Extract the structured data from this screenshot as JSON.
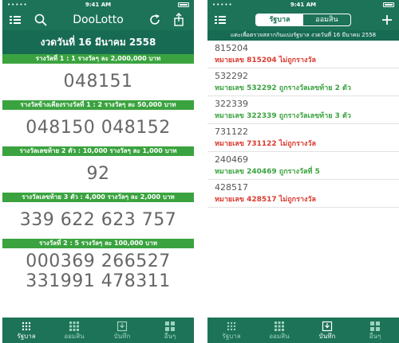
{
  "status": {
    "carrier": "•••••",
    "time": "9:41 AM"
  },
  "left": {
    "nav_title": "DooLotto",
    "date_header": "งวดวันที่ 16 มีนาคม 2558",
    "sections": [
      {
        "label": "รางวัลที่ 1 : 1 รางวัลๆ ละ 2,000,000 บาท",
        "numbers": [
          "048151"
        ]
      },
      {
        "label": "รางวัลข้างเคียงรางวัลที่ 1 : 2 รางวัลๆ ละ 50,000 บาท",
        "numbers": [
          "048150 048152"
        ]
      },
      {
        "label": "รางวัลเลขท้าย 2 ตัว : 10,000 รางวัลๆ ละ 1,000 บาท",
        "numbers": [
          "92"
        ]
      },
      {
        "label": "รางวัลเลขท้าย 3 ตัว : 4,000 รางวัลๆ ละ 2,000 บาท",
        "numbers": [
          "339 622 623 757"
        ]
      },
      {
        "label": "รางวัลที่ 2 : 5 รางวัลๆ ละ 100,000 บาท",
        "numbers": [
          "000369 266527",
          "331991 478311"
        ]
      }
    ]
  },
  "tabs": [
    "รัฐบาล",
    "ออมสิน",
    "บันทึก",
    "อื่นๆ"
  ],
  "right": {
    "segments": [
      "รัฐบาล",
      "ออมสิน"
    ],
    "info": "แตะเพื่อตรวจสลากกินแบ่งรัฐบาล งวดวันที่ 16 มีนาคม 2558",
    "entries": [
      {
        "number": "815204",
        "result": "หมายเลข 815204 ไม่ถูกรางวัล",
        "status": "lost"
      },
      {
        "number": "532292",
        "result": "หมายเลข 532292  ถูกรางวัลเลขท้าย 2 ตัว",
        "status": "won"
      },
      {
        "number": "322339",
        "result": "หมายเลข 322339  ถูกรางวัลเลขท้าย 3 ตัว",
        "status": "won"
      },
      {
        "number": "731122",
        "result": "หมายเลข 731122 ไม่ถูกรางวัล",
        "status": "lost"
      },
      {
        "number": "240469",
        "result": "หมายเลข 240469  ถูกรางวัลที่ 5",
        "status": "won"
      },
      {
        "number": "428517",
        "result": "หมายเลข 428517 ไม่ถูกรางวัล",
        "status": "lost"
      }
    ]
  },
  "colors": {
    "primary": "#1d7358",
    "section_green": "#3aa33f",
    "lost_red": "#d93a2f"
  },
  "icons": {
    "list": "list-icon",
    "search": "search-icon",
    "refresh": "refresh-icon",
    "share": "share-icon",
    "add": "plus-icon"
  }
}
